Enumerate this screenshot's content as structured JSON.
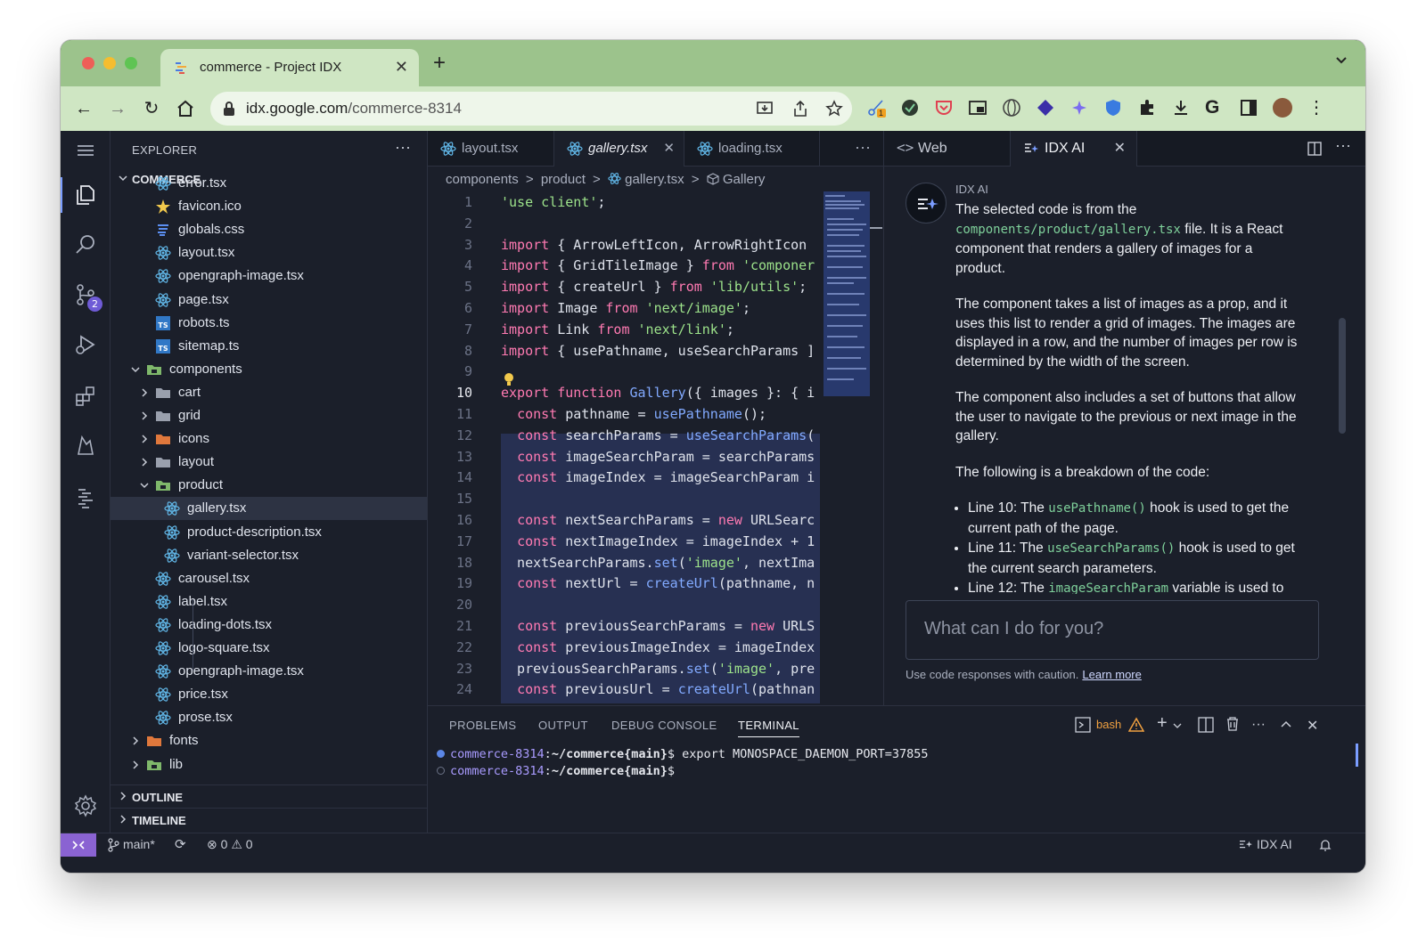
{
  "browser": {
    "tab_title": "commerce - Project IDX",
    "url_host": "idx.google.com",
    "url_path": "/commerce-8314",
    "extension_badge": "1"
  },
  "explorer": {
    "title": "EXPLORER",
    "more": "···",
    "root": "COMMERCE",
    "rows": [
      {
        "name": "error.tsx",
        "icon": "react-icon"
      },
      {
        "name": "favicon.ico",
        "icon": "star-icon"
      },
      {
        "name": "globals.css",
        "icon": "css-icon"
      },
      {
        "name": "layout.tsx",
        "icon": "react-icon"
      },
      {
        "name": "opengraph-image.tsx",
        "icon": "react-icon"
      },
      {
        "name": "page.tsx",
        "icon": "react-icon"
      },
      {
        "name": "robots.ts",
        "icon": "ts-icon"
      },
      {
        "name": "sitemap.ts",
        "icon": "ts-icon"
      },
      {
        "name": "components",
        "icon": "folder-open-icon"
      },
      {
        "name": "cart",
        "icon": "folder-icon"
      },
      {
        "name": "grid",
        "icon": "folder-icon"
      },
      {
        "name": "icons",
        "icon": "folder-icon"
      },
      {
        "name": "layout",
        "icon": "folder-icon"
      },
      {
        "name": "product",
        "icon": "folder-open-icon"
      },
      {
        "name": "gallery.tsx",
        "icon": "react-icon"
      },
      {
        "name": "product-description.tsx",
        "icon": "react-icon"
      },
      {
        "name": "variant-selector.tsx",
        "icon": "react-icon"
      },
      {
        "name": "carousel.tsx",
        "icon": "react-icon"
      },
      {
        "name": "label.tsx",
        "icon": "react-icon"
      },
      {
        "name": "loading-dots.tsx",
        "icon": "react-icon"
      },
      {
        "name": "logo-square.tsx",
        "icon": "react-icon"
      },
      {
        "name": "opengraph-image.tsx",
        "icon": "react-icon"
      },
      {
        "name": "price.tsx",
        "icon": "react-icon"
      },
      {
        "name": "prose.tsx",
        "icon": "react-icon"
      },
      {
        "name": "fonts",
        "icon": "folder-icon"
      },
      {
        "name": "lib",
        "icon": "folder-icon"
      }
    ],
    "outline": "OUTLINE",
    "timeline": "TIMELINE"
  },
  "editor": {
    "tabs": [
      "layout.tsx",
      "gallery.tsx",
      "loading.tsx"
    ],
    "more": "···",
    "breadcrumb": [
      "components",
      ">",
      "product",
      ">",
      "gallery.tsx",
      ">",
      "Gallery"
    ],
    "line_numbers": [
      "1",
      "2",
      "3",
      "4",
      "5",
      "6",
      "7",
      "8",
      "9",
      "10",
      "11",
      "12",
      "13",
      "14",
      "15",
      "16",
      "17",
      "18",
      "19",
      "20",
      "21",
      "22",
      "23",
      "24"
    ],
    "lines": [
      "'use client';",
      "",
      "import { ArrowLeftIcon, ArrowRightIcon",
      "import { GridTileImage } from 'componer",
      "import { createUrl } from 'lib/utils';",
      "import Image from 'next/image';",
      "import Link from 'next/link';",
      "import { usePathname, useSearchParams ]",
      "",
      "export function Gallery({ images }: { i",
      "  const pathname = usePathname();",
      "  const searchParams = useSearchParams(",
      "  const imageSearchParam = searchParams",
      "  const imageIndex = imageSearchParam i",
      "",
      "  const nextSearchParams = new URLSearc",
      "  const nextImageIndex = imageIndex + 1",
      "  nextSearchParams.set('image', nextIma",
      "  const nextUrl = createUrl(pathname, n",
      "",
      "  const previousSearchParams = new URLS",
      "  const previousImageIndex = imageIndex",
      "  previousSearchParams.set('image', pre",
      "  const previousUrl = createUrl(pathnan"
    ]
  },
  "right": {
    "tab_web": "Web",
    "tab_ai": "IDX AI",
    "more": "···",
    "ai_name": "IDX AI",
    "p1_a": "The selected code is from the",
    "p1_code": "components/product/gallery.tsx",
    "p1_b": "file. It is a React component that renders a gallery of images for a product.",
    "p2": "The component takes a list of images as a prop, and it uses this list to render a grid of images. The images are displayed in a row, and the number of images per row is determined by the width of the screen.",
    "p3": "The component also includes a set of buttons that allow the user to navigate to the previous or next image in the gallery.",
    "p4": "The following is a breakdown of the code:",
    "b1_a": "Line 10: The",
    "b1_code": "usePathname()",
    "b1_b": "hook is used to get the current path of the page.",
    "b2_a": "Line 11: The",
    "b2_code": "useSearchParams()",
    "b2_b": "hook is used to get the current search parameters.",
    "b3_a": "Line 12: The",
    "b3_code": "imageSearchParam",
    "b3_b": "variable is used to",
    "input_placeholder": "What can I do for you?",
    "caution": "Use code responses with caution.",
    "learn_more": "Learn more"
  },
  "panel": {
    "tabs": [
      "PROBLEMS",
      "OUTPUT",
      "DEBUG CONSOLE",
      "TERMINAL"
    ],
    "shell": "bash",
    "more": "···",
    "term_host": "commerce-8314",
    "term_sep": ":",
    "term_path": "~/commerce",
    "term_branch": "{main}",
    "term_prompt": "$",
    "term_cmd": " export MONOSPACE_DAEMON_PORT=37855"
  },
  "status": {
    "branch": "main*",
    "errors": "0",
    "warnings": "0",
    "ai": "IDX AI"
  },
  "colors": {
    "chrome_frame": "#9cc38c",
    "chrome_toolbar": "#cfe6c3",
    "ide_bg": "#1b1f2a",
    "accent": "#7b9dff",
    "remote": "#8a63d2"
  }
}
